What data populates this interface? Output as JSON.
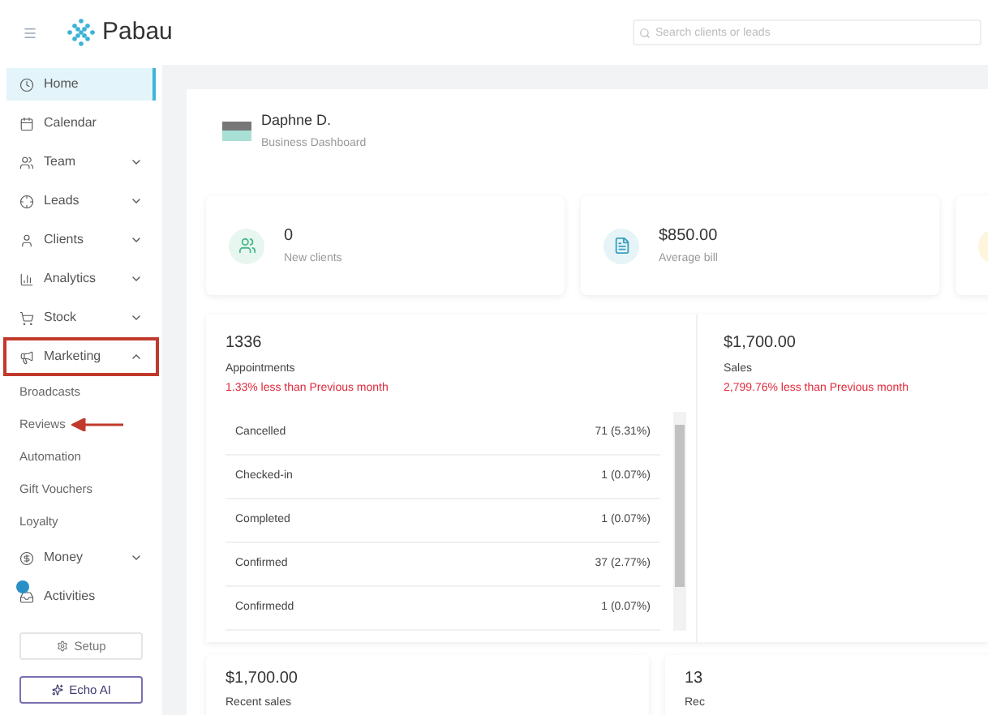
{
  "brand": {
    "name": "Pabau"
  },
  "search": {
    "placeholder": "Search clients or leads"
  },
  "sidebar": {
    "items": [
      {
        "label": "Home",
        "selected": true
      },
      {
        "label": "Calendar",
        "selected": false
      },
      {
        "label": "Team",
        "selected": false,
        "expanded": false
      },
      {
        "label": "Leads",
        "selected": false,
        "expanded": false
      },
      {
        "label": "Clients",
        "selected": false,
        "expanded": false
      },
      {
        "label": "Analytics",
        "selected": false,
        "expanded": false
      },
      {
        "label": "Stock",
        "selected": false,
        "expanded": false
      },
      {
        "label": "Marketing",
        "selected": false,
        "expanded": true,
        "highlighted": true,
        "children": [
          {
            "label": "Broadcasts",
            "arrow": false
          },
          {
            "label": "Reviews",
            "arrow": true
          },
          {
            "label": "Automation",
            "arrow": false
          },
          {
            "label": "Gift Vouchers",
            "arrow": false
          },
          {
            "label": "Loyalty",
            "arrow": false
          }
        ]
      },
      {
        "label": "Money",
        "selected": false,
        "expanded": false
      },
      {
        "label": "Activities",
        "selected": false,
        "badge": true
      }
    ],
    "buttons": [
      {
        "label": "Setup"
      },
      {
        "label": "Echo AI"
      }
    ]
  },
  "profile": {
    "name": "Daphne D.",
    "subtitle": "Business Dashboard"
  },
  "stats": [
    {
      "kind": "stat",
      "value": "0",
      "label": "New clients"
    },
    {
      "kind": "stat",
      "value": "$850.00",
      "label": "Average bill"
    },
    {
      "kind": "partial"
    }
  ],
  "appointments": {
    "value": "1336",
    "label": "Appointments",
    "change": "1.33% less than Previous month",
    "rows": [
      {
        "status": "Cancelled",
        "count": "71 (5.31%)"
      },
      {
        "status": "Checked-in",
        "count": "1 (0.07%)"
      },
      {
        "status": "Completed",
        "count": "1 (0.07%)"
      },
      {
        "status": "Confirmed",
        "count": "37 (2.77%)"
      },
      {
        "status": "Confirmedd",
        "count": "1 (0.07%)"
      }
    ]
  },
  "sales": {
    "value": "$1,700.00",
    "label": "Sales",
    "change": "2,799.76% less than Previous month"
  },
  "bottom_cards": [
    {
      "value": "$1,700.00",
      "label": "Recent sales"
    },
    {
      "value": "13",
      "label": "Rec"
    }
  ]
}
